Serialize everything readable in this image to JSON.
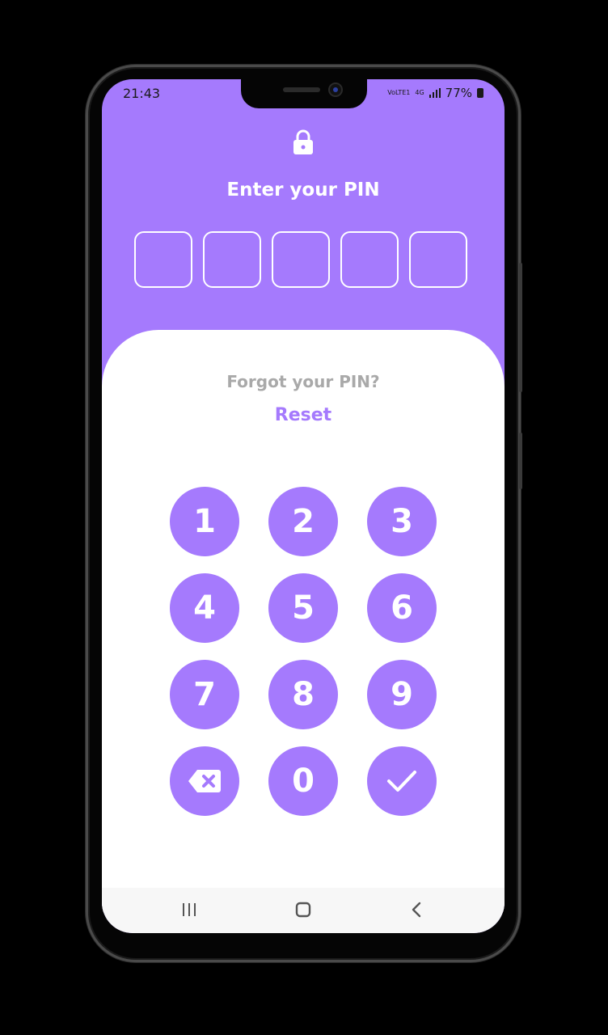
{
  "status": {
    "time": "21:43",
    "network_top": "VoLTE1",
    "network_gen": "4G",
    "battery": "77%"
  },
  "header": {
    "icon": "lock-icon",
    "title": "Enter your PIN",
    "pin_length": 5
  },
  "help": {
    "forgot_text": "Forgot your PIN?",
    "reset_label": "Reset"
  },
  "keypad": {
    "keys": [
      "1",
      "2",
      "3",
      "4",
      "5",
      "6",
      "7",
      "8",
      "9"
    ],
    "zero": "0",
    "backspace_icon": "backspace-icon",
    "confirm_icon": "check-icon"
  },
  "colors": {
    "accent": "#a57afd",
    "muted_text": "#a9a9a9",
    "panel": "#ffffff"
  },
  "nav": {
    "icons": [
      "recent-apps-icon",
      "home-icon",
      "back-icon"
    ]
  }
}
